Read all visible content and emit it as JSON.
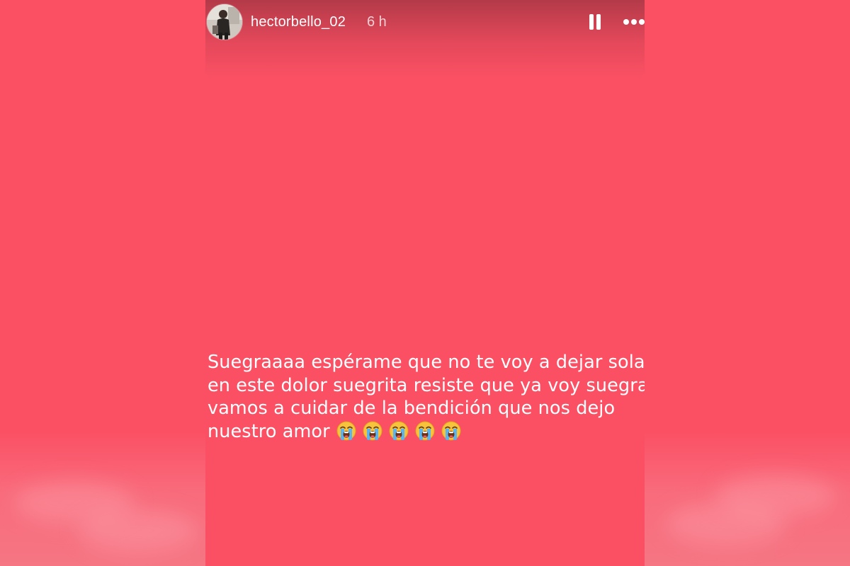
{
  "story": {
    "username": "hectorbello_02",
    "time": "6 h",
    "caption_lines": [
      "Suegraaaa espérame que no te voy a dejar sola",
      "en este dolor suegrita resiste que ya voy suegra",
      "vamos a cuidar de la bendición que nos dejo",
      "nuestro amor"
    ],
    "emoji": "loudly-crying-face",
    "emoji_count": 5,
    "background_color": "#fb5064"
  },
  "icons": {
    "avatar": "profile-avatar",
    "pause": "pause-icon",
    "more": "more-options-icon"
  }
}
